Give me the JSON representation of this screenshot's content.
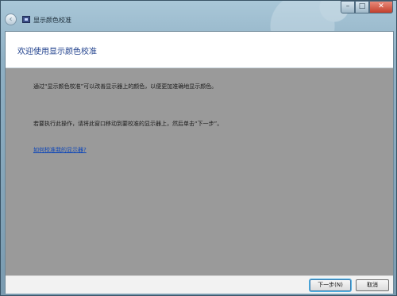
{
  "window": {
    "title": "显示颜色校准",
    "controls": {
      "minimize": "–",
      "maximize": "□",
      "close": "✕"
    },
    "back_icon": "‹"
  },
  "header": {
    "title": "欢迎使用显示颜色校准"
  },
  "body": {
    "paragraph1": "通过“显示颜色校准”可以改善显示器上的颜色，以便更加准确地显示颜色。",
    "paragraph2": "若要执行此操作，请将此窗口移动到要校准的显示器上，然后单击“下一步”。",
    "help_link": "如何校准我的显示器?"
  },
  "footer": {
    "next_label": "下一步(N)",
    "cancel_label": "取消"
  },
  "colors": {
    "accent": "#1e3f8c",
    "link": "#0d46b8",
    "body_bg": "#9a9a9a",
    "close_red": "#c2402d"
  }
}
